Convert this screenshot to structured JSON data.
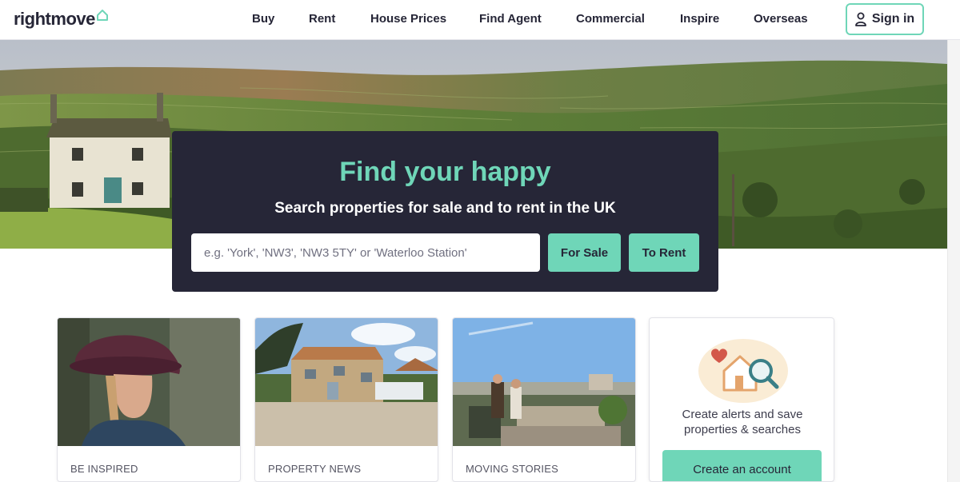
{
  "brand": {
    "name": "rightmove",
    "accent": "#6fd6b8",
    "dark": "#262637"
  },
  "nav": {
    "items": [
      "Buy",
      "Rent",
      "House Prices",
      "Find Agent",
      "Commercial",
      "Inspire",
      "Overseas"
    ],
    "signin_label": "Sign in"
  },
  "search": {
    "title": "Find your happy",
    "subtitle": "Search properties for sale and to rent in the UK",
    "placeholder": "e.g. 'York', 'NW3', 'NW3 5TY' or 'Waterloo Station'",
    "sale_label": "For Sale",
    "rent_label": "To Rent"
  },
  "cards": [
    {
      "label": "BE INSPIRED",
      "icon": "woman-in-hat-photo"
    },
    {
      "label": "PROPERTY NEWS",
      "icon": "stone-cottage-photo"
    },
    {
      "label": "MOVING STORIES",
      "icon": "rooftop-terrace-photo"
    }
  ],
  "account_card": {
    "text_line1": "Create alerts and save",
    "text_line2": "properties & searches",
    "button_label": "Create an account"
  }
}
